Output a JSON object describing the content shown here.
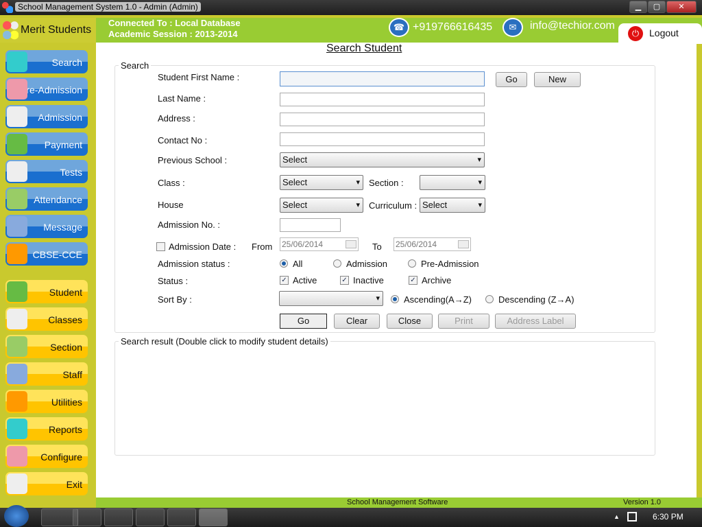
{
  "window": {
    "title": "School Management System 1.0  -  Admin (Admin)",
    "min": "▁",
    "max": "▢",
    "close": "✕"
  },
  "header": {
    "app_name": "Merit Students",
    "connected": "Connected To : Local Database",
    "session": "Academic Session : 2013-2014",
    "phone": "+919766616435",
    "email": "info@techior.com",
    "logout": "Logout"
  },
  "sidebar": {
    "blue": [
      {
        "label": "Search",
        "icon": "search-icon"
      },
      {
        "label": "Pre-Admission",
        "icon": "student-icon"
      },
      {
        "label": "Admission",
        "icon": "form-icon"
      },
      {
        "label": "Payment",
        "icon": "payment-icon"
      },
      {
        "label": "Tests",
        "icon": "checklist-icon"
      },
      {
        "label": "Attendance",
        "icon": "attendance-icon"
      },
      {
        "label": "Message",
        "icon": "mail-icon"
      },
      {
        "label": "CBSE-CCE",
        "icon": "folder-info-icon"
      }
    ],
    "yellow": [
      {
        "label": "Student",
        "icon": "users-icon"
      },
      {
        "label": "Classes",
        "icon": "document-icon"
      },
      {
        "label": "Section",
        "icon": "group-icon"
      },
      {
        "label": "Staff",
        "icon": "staff-icon"
      },
      {
        "label": "Utilities",
        "icon": "tools-icon"
      },
      {
        "label": "Reports",
        "icon": "chart-icon"
      },
      {
        "label": "Configure",
        "icon": "gear-icon"
      },
      {
        "label": "Exit",
        "icon": "exit-door-icon"
      }
    ]
  },
  "page": {
    "title": "Search Student"
  },
  "search": {
    "legend": "Search",
    "first_name": "Student First Name :",
    "last_name": "Last Name :",
    "address": "Address :",
    "contact": "Contact No :",
    "prev_school": "Previous School :",
    "prev_school_value": "Select",
    "class": "Class :",
    "class_value": "Select",
    "section": "Section :",
    "section_value": "",
    "house": "House",
    "house_value": "Select",
    "curriculum": "Curriculum :",
    "curriculum_value": "Select",
    "admission_no": "Admission No. :",
    "admission_date": "Admission Date :",
    "from": "From",
    "from_value": "25/06/2014",
    "to": "To",
    "to_value": "25/06/2014",
    "adm_status": "Admission status :",
    "adm_all": "All",
    "adm_admission": "Admission",
    "adm_pre": "Pre-Admission",
    "status": "Status :",
    "active": "Active",
    "inactive": "Inactive",
    "archive": "Archive",
    "sort_by": "Sort By :",
    "sort_value": "",
    "asc": "Ascending(A→Z)",
    "desc": "Descending (Z→A)",
    "go": "Go",
    "new": "New",
    "go2": "Go",
    "clear": "Clear",
    "close": "Close",
    "print": "Print",
    "address_label": "Address Label"
  },
  "results": {
    "legend": "Search result (Double click to modify student details)"
  },
  "footer": {
    "center": "School Management Software",
    "version": "Version 1.0"
  },
  "taskbar": {
    "time": "6:30 PM",
    "tray_arrow": "▲"
  }
}
